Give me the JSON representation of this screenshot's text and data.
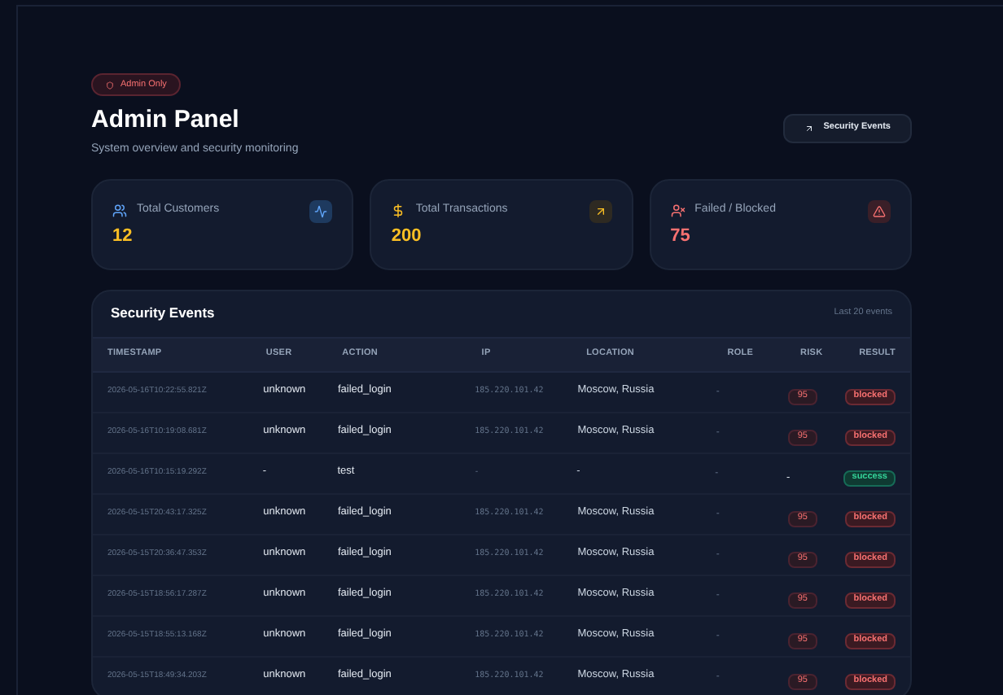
{
  "header": {
    "badge": "Admin Only",
    "title": "Admin Panel",
    "subtitle": "System overview and security monitoring",
    "button": "Security Events"
  },
  "stats": [
    {
      "label": "Total Customers",
      "value": "12",
      "kind": "customers"
    },
    {
      "label": "Total Transactions",
      "value": "200",
      "kind": "transactions"
    },
    {
      "label": "Failed / Blocked",
      "value": "75",
      "kind": "failed"
    }
  ],
  "table": {
    "title": "Security Events",
    "note": "Last 20 events",
    "columns": [
      "TIMESTAMP",
      "USER",
      "ACTION",
      "IP",
      "LOCATION",
      "ROLE",
      "RISK",
      "RESULT"
    ],
    "rows": [
      {
        "timestamp": "2026-05-16T10:22:55.821Z",
        "user": "unknown",
        "action": "failed_login",
        "ip": "185.220.101.42",
        "location": "Moscow, Russia",
        "role": "-",
        "risk": {
          "text": "95",
          "kind": "high"
        },
        "result": {
          "text": "blocked",
          "kind": "blocked"
        }
      },
      {
        "timestamp": "2026-05-16T10:19:08.681Z",
        "user": "unknown",
        "action": "failed_login",
        "ip": "185.220.101.42",
        "location": "Moscow, Russia",
        "role": "-",
        "risk": {
          "text": "95",
          "kind": "high"
        },
        "result": {
          "text": "blocked",
          "kind": "blocked"
        }
      },
      {
        "timestamp": "2026-05-16T10:15:19.292Z",
        "user": "-",
        "action": "test",
        "ip": "-",
        "location": "-",
        "role": "-",
        "risk": {
          "text": "-",
          "kind": "none"
        },
        "result": {
          "text": "success",
          "kind": "success"
        }
      },
      {
        "timestamp": "2026-05-15T20:43:17.325Z",
        "user": "unknown",
        "action": "failed_login",
        "ip": "185.220.101.42",
        "location": "Moscow, Russia",
        "role": "-",
        "risk": {
          "text": "95",
          "kind": "high"
        },
        "result": {
          "text": "blocked",
          "kind": "blocked"
        }
      },
      {
        "timestamp": "2026-05-15T20:36:47.353Z",
        "user": "unknown",
        "action": "failed_login",
        "ip": "185.220.101.42",
        "location": "Moscow, Russia",
        "role": "-",
        "risk": {
          "text": "95",
          "kind": "high"
        },
        "result": {
          "text": "blocked",
          "kind": "blocked"
        }
      },
      {
        "timestamp": "2026-05-15T18:56:17.287Z",
        "user": "unknown",
        "action": "failed_login",
        "ip": "185.220.101.42",
        "location": "Moscow, Russia",
        "role": "-",
        "risk": {
          "text": "95",
          "kind": "high"
        },
        "result": {
          "text": "blocked",
          "kind": "blocked"
        }
      },
      {
        "timestamp": "2026-05-15T18:55:13.168Z",
        "user": "unknown",
        "action": "failed_login",
        "ip": "185.220.101.42",
        "location": "Moscow, Russia",
        "role": "-",
        "risk": {
          "text": "95",
          "kind": "high"
        },
        "result": {
          "text": "blocked",
          "kind": "blocked"
        }
      },
      {
        "timestamp": "2026-05-15T18:49:34.203Z",
        "user": "unknown",
        "action": "failed_login",
        "ip": "185.220.101.42",
        "location": "Moscow, Russia",
        "role": "-",
        "risk": {
          "text": "95",
          "kind": "high"
        },
        "result": {
          "text": "blocked",
          "kind": "blocked"
        }
      }
    ]
  }
}
